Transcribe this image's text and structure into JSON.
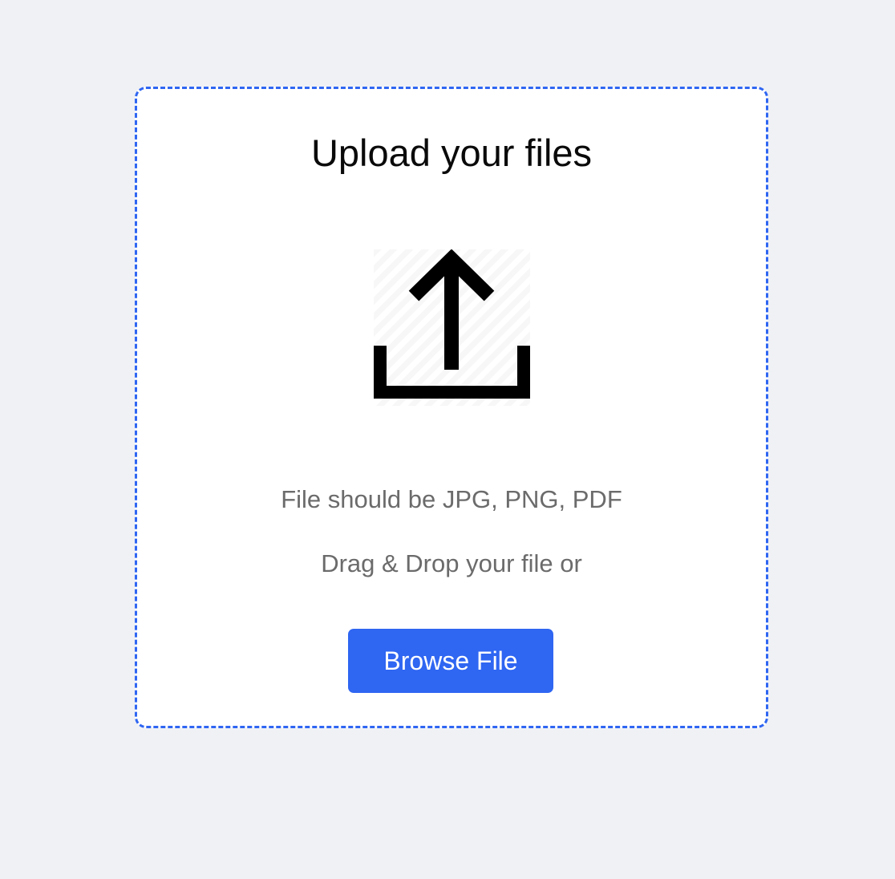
{
  "upload": {
    "title": "Upload your files",
    "icon": "upload-icon",
    "format_hint": "File should be JPG, PNG, PDF",
    "drag_hint": "Drag & Drop your file or",
    "browse_label": "Browse File"
  },
  "colors": {
    "accent": "#2f66f2",
    "page_background": "#f0f1f5",
    "card_background": "#ffffff",
    "muted_text": "#6b6b6b",
    "icon": "#000000"
  }
}
